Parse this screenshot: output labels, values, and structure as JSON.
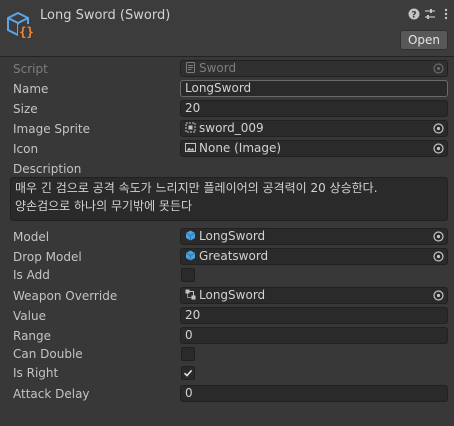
{
  "header": {
    "title": "Long Sword (Sword)",
    "open_label": "Open",
    "icons": [
      "scriptable-object-icon",
      "help-icon",
      "settings-sliders-icon",
      "kebab-menu-icon"
    ]
  },
  "script": {
    "label": "Script",
    "value": "Sword"
  },
  "name": {
    "label": "Name",
    "value": "LongSword"
  },
  "size": {
    "label": "Size",
    "value": "20"
  },
  "image_sprite": {
    "label": "Image Sprite",
    "value": "sword_009"
  },
  "icon_field": {
    "label": "Icon",
    "value": "None (Image)"
  },
  "description": {
    "label": "Description",
    "lines": [
      "매우 긴 검으로 공격 속도가 느리지만 플레이어의 공격력이 20 상승한다.",
      "양손검으로 하나의 무기밖에 못든다"
    ]
  },
  "model": {
    "label": "Model",
    "value": "LongSword"
  },
  "drop_model": {
    "label": "Drop Model",
    "value": "Greatsword"
  },
  "is_add": {
    "label": "Is Add",
    "checked": false
  },
  "weapon_override": {
    "label": "Weapon Override",
    "value": "LongSword"
  },
  "value_field": {
    "label": "Value",
    "value": "20"
  },
  "range": {
    "label": "Range",
    "value": "0"
  },
  "can_double": {
    "label": "Can Double",
    "checked": false
  },
  "is_right": {
    "label": "Is Right",
    "checked": true
  },
  "attack_delay": {
    "label": "Attack Delay",
    "value": "0"
  },
  "colors": {
    "background": "#383838",
    "field": "#2a2a2a",
    "prefab_blue": "#4aa3e0",
    "so_icon_blue": "#5aa6e6",
    "so_icon_orange": "#f08a3a"
  }
}
